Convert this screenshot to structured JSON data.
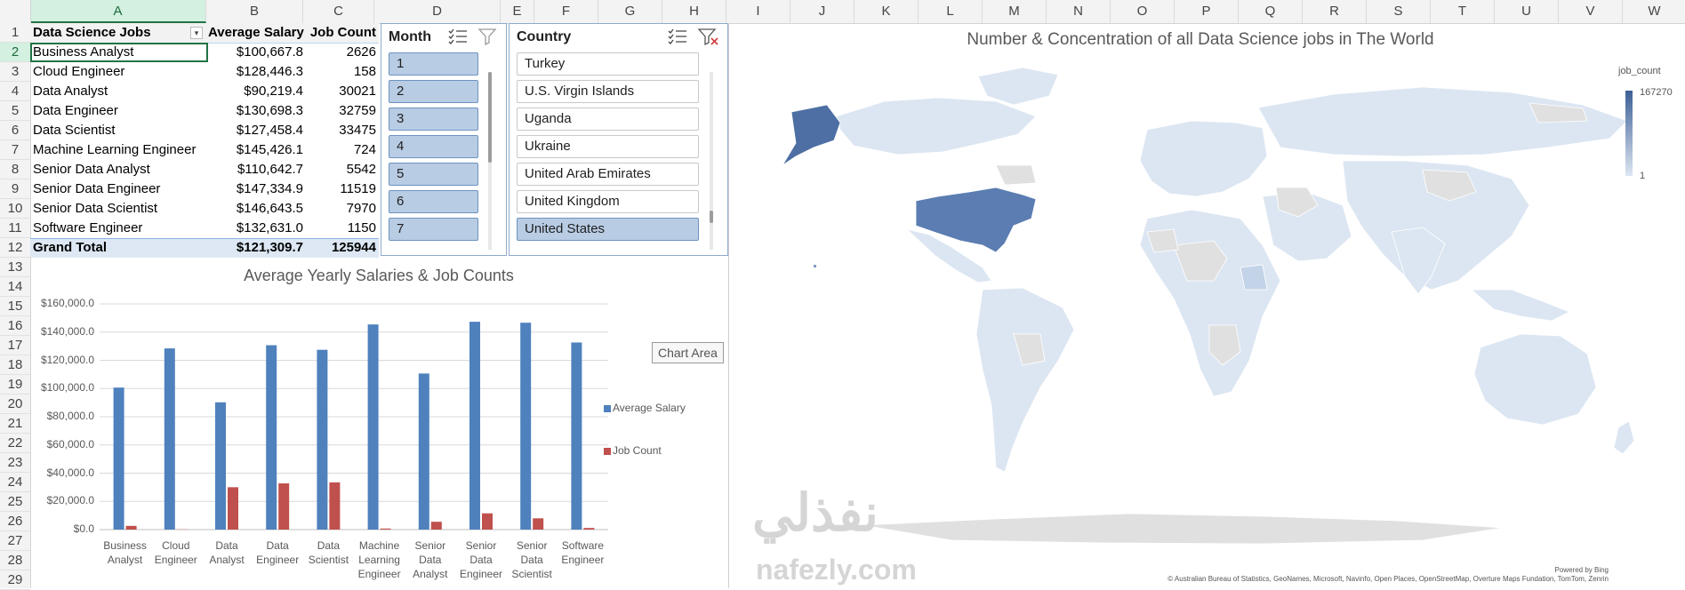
{
  "columns": [
    "A",
    "B",
    "C",
    "D",
    "E",
    "F",
    "G",
    "H",
    "I",
    "J",
    "K",
    "L",
    "M",
    "N",
    "O",
    "P",
    "Q",
    "R",
    "S",
    "T",
    "U",
    "V",
    "W"
  ],
  "rows": [
    "1",
    "2",
    "3",
    "4",
    "5",
    "6",
    "7",
    "8",
    "9",
    "10",
    "11",
    "12",
    "13",
    "14",
    "15",
    "16",
    "17",
    "18",
    "19",
    "20",
    "21",
    "22",
    "23",
    "24",
    "25",
    "26",
    "27",
    "28",
    "29"
  ],
  "pivot": {
    "headers": [
      "Data Science Jobs",
      "Average Salary",
      "Job Count"
    ],
    "rows": [
      {
        "job": "Business Analyst",
        "salary": "$100,667.8",
        "count": "2626"
      },
      {
        "job": "Cloud Engineer",
        "salary": "$128,446.3",
        "count": "158"
      },
      {
        "job": "Data Analyst",
        "salary": "$90,219.4",
        "count": "30021"
      },
      {
        "job": "Data Engineer",
        "salary": "$130,698.3",
        "count": "32759"
      },
      {
        "job": "Data Scientist",
        "salary": "$127,458.4",
        "count": "33475"
      },
      {
        "job": "Machine Learning Engineer",
        "salary": "$145,426.1",
        "count": "724"
      },
      {
        "job": "Senior Data Analyst",
        "salary": "$110,642.7",
        "count": "5542"
      },
      {
        "job": "Senior Data Engineer",
        "salary": "$147,334.9",
        "count": "11519"
      },
      {
        "job": "Senior Data Scientist",
        "salary": "$146,643.5",
        "count": "7970"
      },
      {
        "job": "Software Engineer",
        "salary": "$132,631.0",
        "count": "1150"
      }
    ],
    "total": {
      "label": "Grand Total",
      "salary": "$121,309.7",
      "count": "125944"
    }
  },
  "month_slicer": {
    "title": "Month",
    "items": [
      "1",
      "2",
      "3",
      "4",
      "5",
      "6",
      "7"
    ],
    "selected": [
      true,
      true,
      true,
      true,
      true,
      true,
      true
    ]
  },
  "country_slicer": {
    "title": "Country",
    "items": [
      "Turkey",
      "U.S. Virgin Islands",
      "Uganda",
      "Ukraine",
      "United Arab Emirates",
      "United Kingdom",
      "United States"
    ],
    "selected": [
      false,
      false,
      false,
      false,
      false,
      false,
      true
    ]
  },
  "chart_data": [
    {
      "type": "bar",
      "title": "Average Yearly Salaries & Job Counts",
      "categories": [
        "Business Analyst",
        "Cloud Engineer",
        "Data Analyst",
        "Data Engineer",
        "Data Scientist",
        "Machine Learning Engineer",
        "Senior Data Analyst",
        "Senior Data Engineer",
        "Senior Data Scientist",
        "Software Engineer"
      ],
      "category_lines": [
        [
          "Business",
          "Analyst"
        ],
        [
          "Cloud",
          "Engineer"
        ],
        [
          "Data",
          "Analyst"
        ],
        [
          "Data",
          "Engineer"
        ],
        [
          "Data",
          "Scientist"
        ],
        [
          "Machine",
          "Learning",
          "Engineer"
        ],
        [
          "Senior",
          "Data",
          "Analyst"
        ],
        [
          "Senior",
          "Data",
          "Engineer"
        ],
        [
          "Senior",
          "Data",
          "Scientist"
        ],
        [
          "Software",
          "Engineer"
        ]
      ],
      "series": [
        {
          "name": "Average Salary",
          "color": "#4f81bd",
          "values": [
            100667.8,
            128446.3,
            90219.4,
            130698.3,
            127458.4,
            145426.1,
            110642.7,
            147334.9,
            146643.5,
            132631.0
          ]
        },
        {
          "name": "Job Count",
          "color": "#c0504d",
          "values": [
            2626,
            158,
            30021,
            32759,
            33475,
            724,
            5542,
            11519,
            7970,
            1150
          ]
        }
      ],
      "yticks": [
        "$0.0",
        "$20,000.0",
        "$40,000.0",
        "$60,000.0",
        "$80,000.0",
        "$100,000.0",
        "$120,000.0",
        "$140,000.0",
        "$160,000.0"
      ],
      "ylim": [
        0,
        160000
      ],
      "legend": "right",
      "grid": true
    },
    {
      "type": "map",
      "title": "Number & Concentration of all Data Science jobs in The World",
      "legend_title": "job_count",
      "legend_max": "167270",
      "legend_min": "1",
      "color_low": "#dce6f2",
      "color_high": "#3d5f96",
      "no_data_color": "#e0e0e0"
    }
  ],
  "tooltip": "Chart Area",
  "map_footer": {
    "powered": "Powered by Bing",
    "credits": "© Australian Bureau of Statistics, GeoNames, Microsoft, Navinfo, Open Places, OpenStreetMap, Overture Maps Fundation, TomTom, Zenrin"
  },
  "watermark": {
    "arabic": "نفذلي",
    "latin": "nafezly.com"
  }
}
